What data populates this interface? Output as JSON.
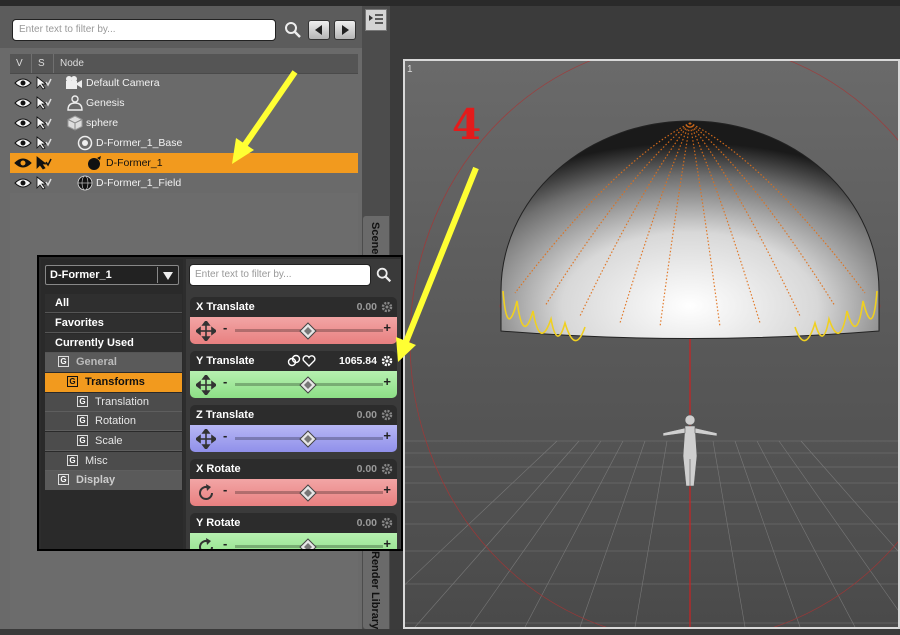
{
  "scene": {
    "filter_placeholder": "Enter text to filter by...",
    "columns": {
      "v": "V",
      "s": "S",
      "node": "Node"
    },
    "nodes": [
      {
        "label": "Default Camera",
        "icon": "camera-icon",
        "selected": false
      },
      {
        "label": "Genesis",
        "icon": "figure-icon",
        "selected": false
      },
      {
        "label": "sphere",
        "icon": "primitive-icon",
        "selected": false
      },
      {
        "label": "D-Former_1_Base",
        "icon": "dformer-base-icon",
        "selected": false
      },
      {
        "label": "D-Former_1",
        "icon": "dformer-icon",
        "selected": true
      },
      {
        "label": "D-Former_1_Field",
        "icon": "field-sphere-icon",
        "selected": false
      }
    ]
  },
  "side_tabs": {
    "scene": "Scene",
    "render_library": "Render Library"
  },
  "viewport": {
    "index": "1"
  },
  "annotation": {
    "step": "4",
    "arrow_color": "#ffff33"
  },
  "parameters": {
    "node_name": "D-Former_1",
    "filter_placeholder": "Enter text to filter by...",
    "categories": {
      "all": "All",
      "favorites": "Favorites",
      "currently_used": "Currently Used",
      "general": "General",
      "transforms": "Transforms",
      "translation": "Translation",
      "rotation": "Rotation",
      "scale": "Scale",
      "misc": "Misc",
      "display": "Display"
    },
    "group_glyph": "G",
    "sliders": [
      {
        "name": "X Translate",
        "value": "0.00",
        "color": "red"
      },
      {
        "name": "Y Translate",
        "value": "1065.84",
        "color": "green"
      },
      {
        "name": "Z Translate",
        "value": "0.00",
        "color": "blue"
      },
      {
        "name": "X Rotate",
        "value": "0.00",
        "color": "red"
      },
      {
        "name": "Y Rotate",
        "value": "0.00",
        "color": "green"
      }
    ],
    "minus": "-",
    "plus": "+"
  },
  "colors": {
    "selection": "#f29a1e",
    "accent_red": "#e31b1b"
  }
}
